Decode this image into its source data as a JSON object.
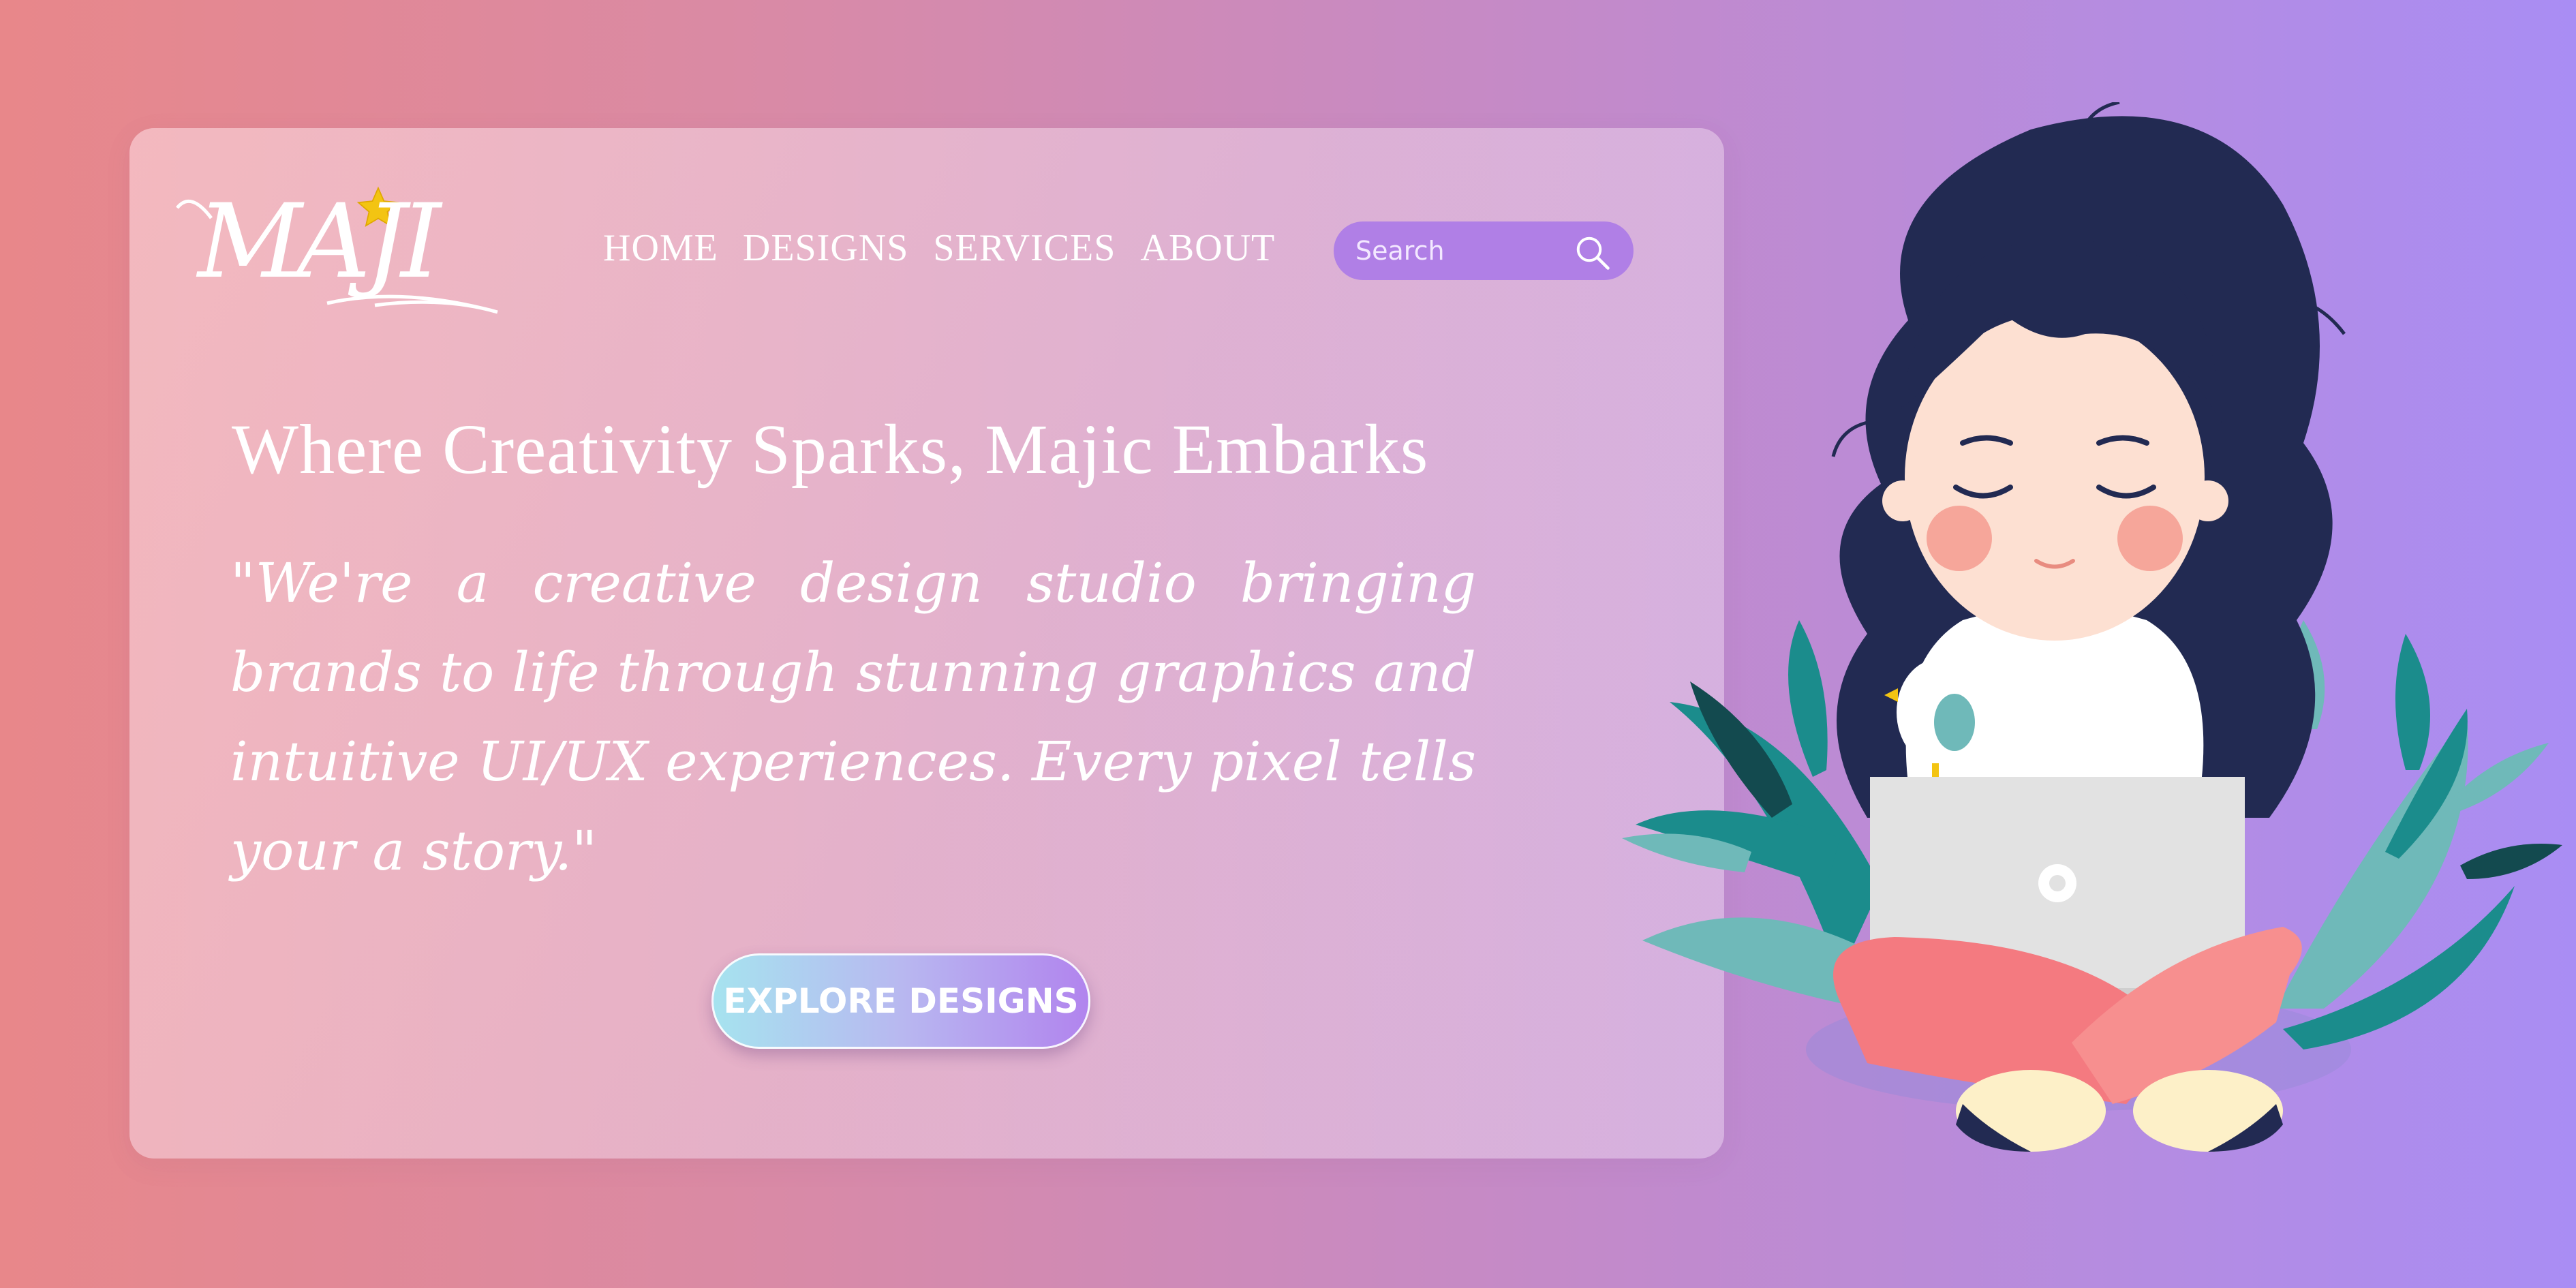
{
  "brand": {
    "logo_text": "MAJI"
  },
  "nav": {
    "items": [
      "HOME",
      "DESIGNS",
      "SERVICES",
      "ABOUT"
    ]
  },
  "search": {
    "placeholder": "Search"
  },
  "hero": {
    "headline": "Where Creativity Sparks, Majic Embarks",
    "tagline": "\"We're a creative design studio bringing brands to life through stunning graphics and intuitive UI/UX experiences. Every pixel tells your a story.\"",
    "cta_label": "EXPLORE DESIGNS"
  },
  "icons": {
    "logo_star": "star-icon",
    "search": "search-icon",
    "illustration": "woman-with-laptop-illustration"
  },
  "colors": {
    "background_left": "#e8878a",
    "background_right": "#a98df4",
    "search_bg": "#b07fe6",
    "hair": "#222a52",
    "leaves": "#1c8a8a",
    "pants": "#f47a80"
  }
}
